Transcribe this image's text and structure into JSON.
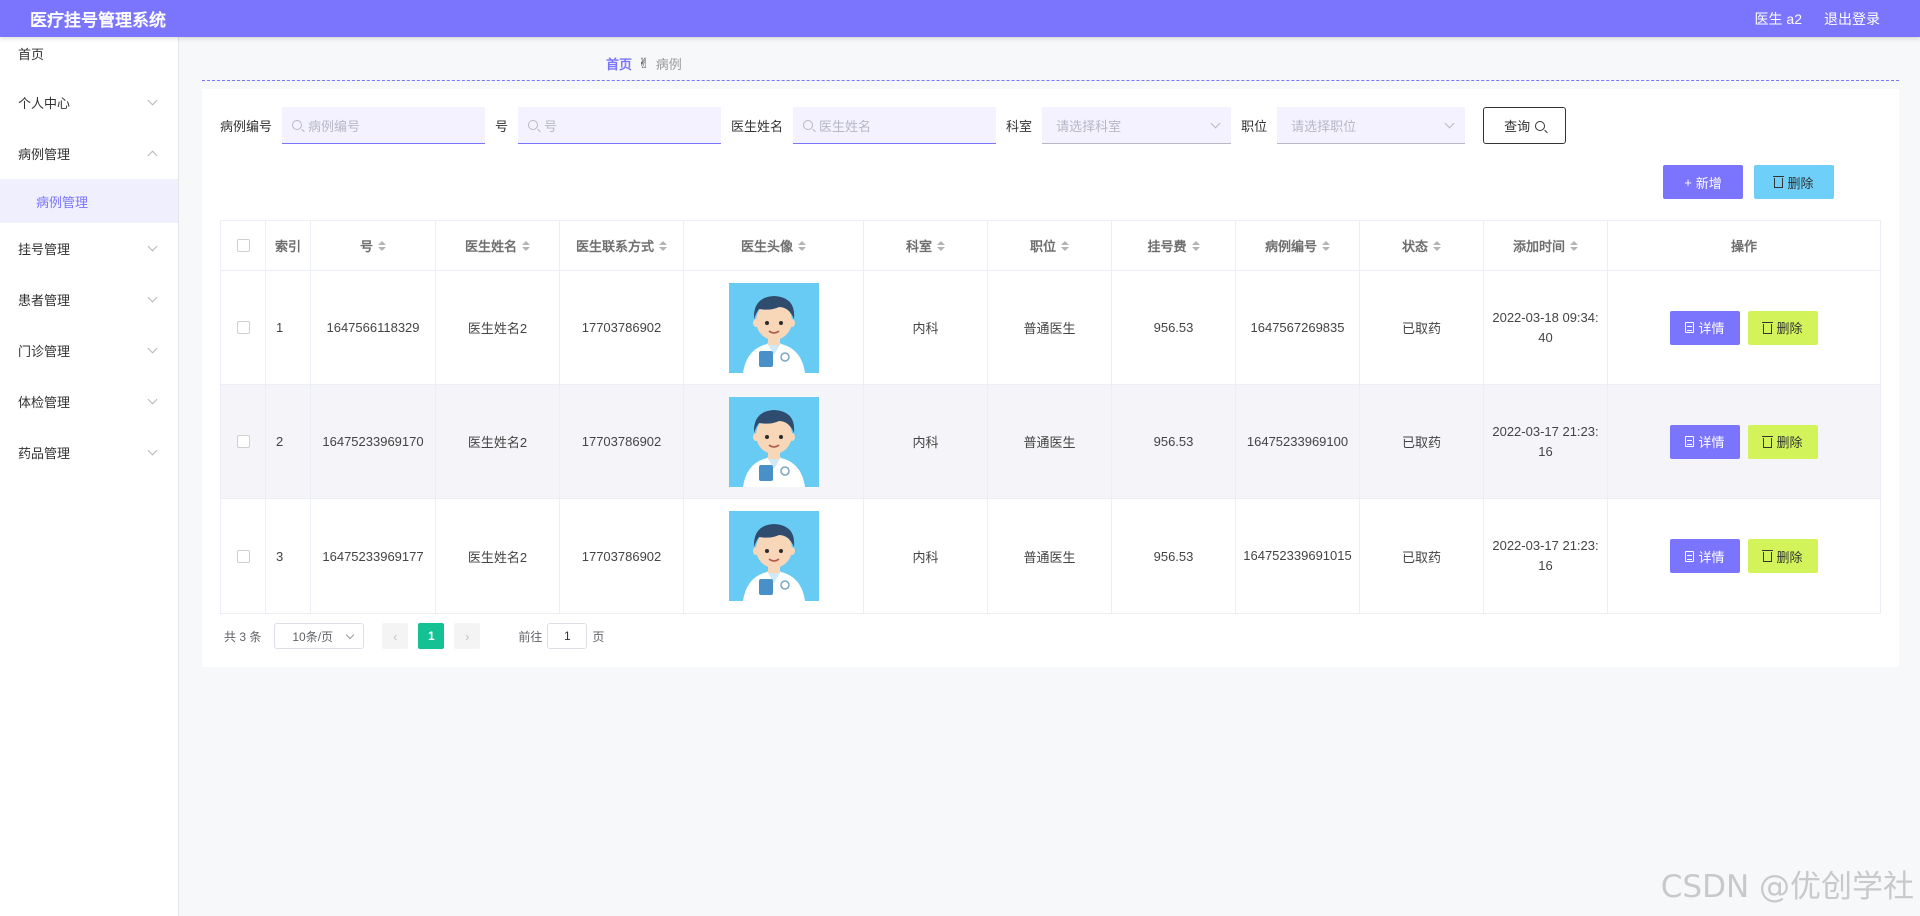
{
  "header": {
    "title": "医疗挂号管理系统",
    "user": "医生 a2",
    "logout": "退出登录"
  },
  "sidebar": {
    "items": [
      {
        "label": "首页"
      },
      {
        "label": "个人中心"
      },
      {
        "label": "病例管理",
        "sub": "病例管理"
      },
      {
        "label": "挂号管理"
      },
      {
        "label": "患者管理"
      },
      {
        "label": "门诊管理"
      },
      {
        "label": "体检管理"
      },
      {
        "label": "药品管理"
      }
    ]
  },
  "breadcrumb": {
    "home": "首页",
    "icon": "✌",
    "current": "病例"
  },
  "search": {
    "case_no_label": "病例编号",
    "case_no_placeholder": "病例编号",
    "no_label": "号",
    "no_placeholder": "号",
    "doctor_label": "医生姓名",
    "doctor_placeholder": "医生姓名",
    "dept_label": "科室",
    "dept_placeholder": "请选择科室",
    "title_label": "职位",
    "title_placeholder": "请选择职位",
    "query_btn": "查询"
  },
  "actions": {
    "add": "新增",
    "delete": "删除"
  },
  "table": {
    "headers": [
      "索引",
      "号",
      "医生姓名",
      "医生联系方式",
      "医生头像",
      "科室",
      "职位",
      "挂号费",
      "病例编号",
      "状态",
      "添加时间",
      "操作"
    ],
    "rows": [
      {
        "index": "1",
        "no": "1647566118329",
        "doctor": "医生姓名2",
        "phone": "17703786902",
        "dept": "内科",
        "title": "普通医生",
        "fee": "956.53",
        "case_no": "1647567269835",
        "status": "已取药",
        "time": "2022-03-18 09:34:40"
      },
      {
        "index": "2",
        "no": "16475233969170",
        "doctor": "医生姓名2",
        "phone": "17703786902",
        "dept": "内科",
        "title": "普通医生",
        "fee": "956.53",
        "case_no": "16475233969100",
        "status": "已取药",
        "time": "2022-03-17 21:23:16"
      },
      {
        "index": "3",
        "no": "16475233969177",
        "doctor": "医生姓名2",
        "phone": "17703786902",
        "dept": "内科",
        "title": "普通医生",
        "fee": "956.53",
        "case_no": "164752339691015",
        "status": "已取药",
        "time": "2022-03-17 21:23:16"
      }
    ],
    "detail_btn": "详情",
    "row_delete_btn": "删除"
  },
  "pagination": {
    "total": "共 3 条",
    "page_size": "10条/页",
    "current": "1",
    "goto_label": "前往",
    "goto_value": "1",
    "page_suffix": "页"
  },
  "watermark": "CSDN @优创学社",
  "colors": {
    "primary": "#7b74fc",
    "info": "#6ecff8",
    "danger_light": "#d2f45a",
    "page_active": "#13c193"
  }
}
